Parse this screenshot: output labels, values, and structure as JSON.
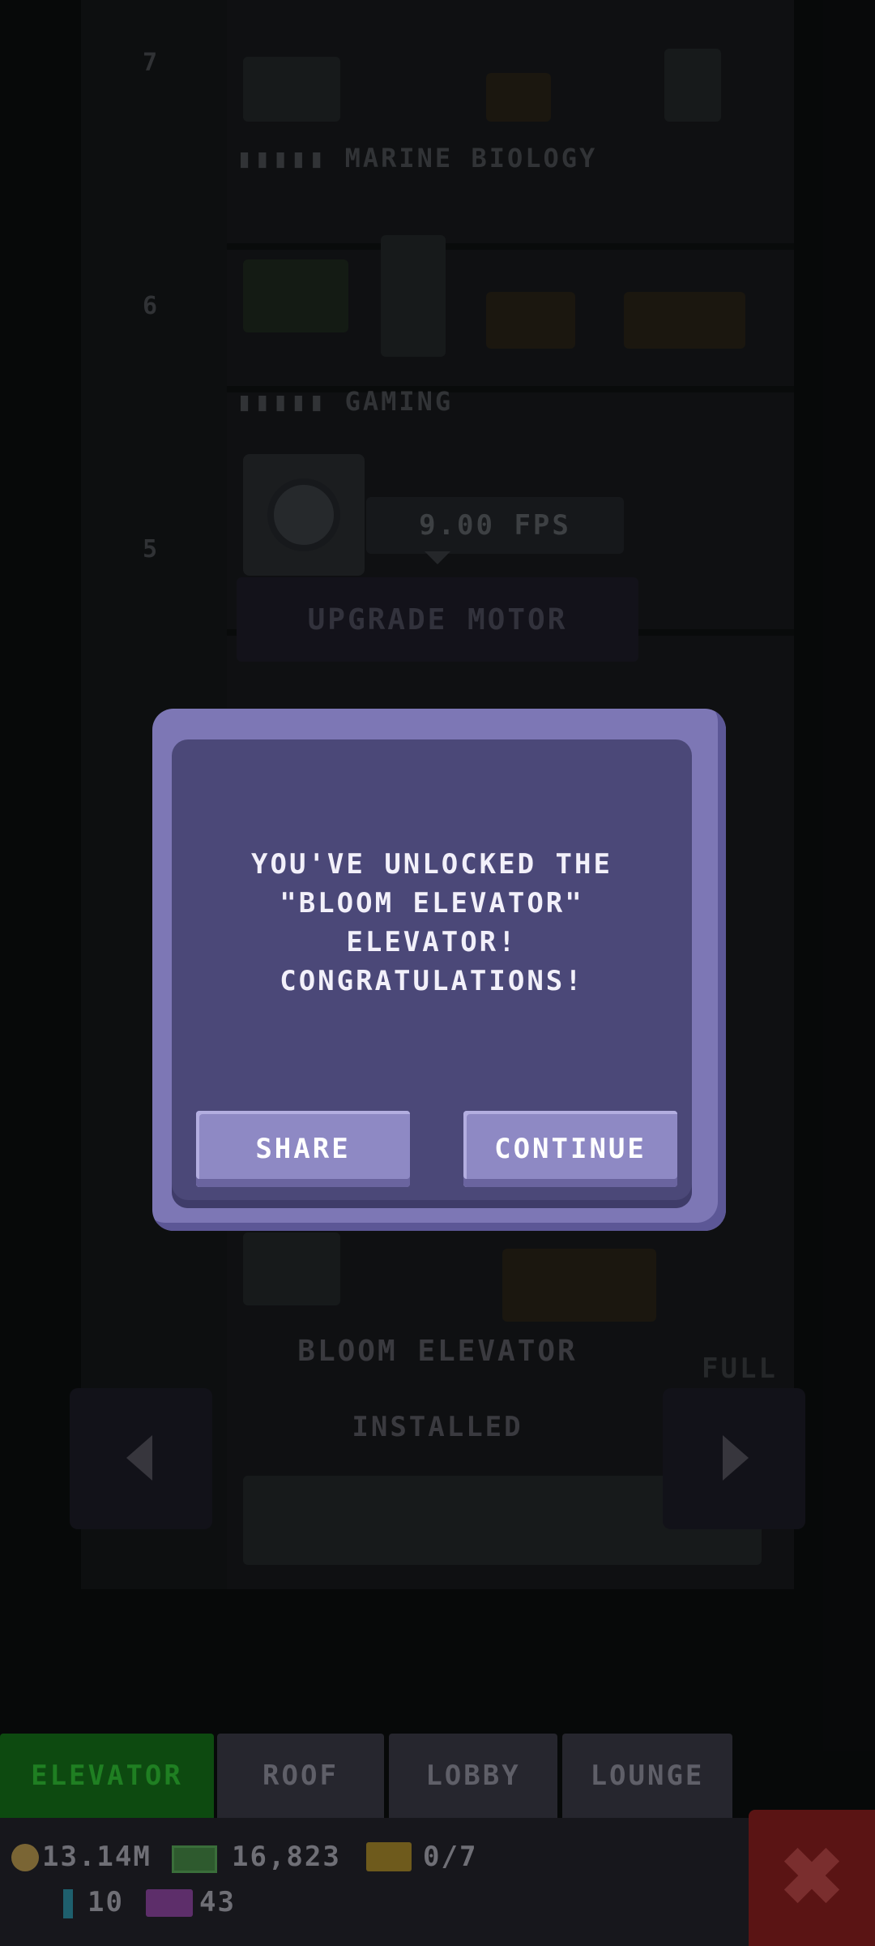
{
  "scene": {
    "floors": [
      {
        "label": "▮▮▮▮▮ MARINE BIOLOGY",
        "number": "7"
      },
      {
        "label": "▮▮▮▮▮ GAMING",
        "number": "6"
      },
      {
        "label": "",
        "number": "5"
      }
    ],
    "motor": {
      "fps": "9.00 FPS",
      "upgrade_label": "UPGRADE MOTOR"
    },
    "elevator_name": "BLOOM ELEVATOR",
    "elevator_status": "INSTALLED",
    "ghost_label": "FULL"
  },
  "modal": {
    "message_lines": [
      "YOU'VE UNLOCKED THE",
      "\"BLOOM ELEVATOR\"",
      "ELEVATOR!",
      "CONGRATULATIONS!"
    ],
    "share_label": "SHARE",
    "continue_label": "CONTINUE"
  },
  "tabs": [
    {
      "label": "ELEVATOR",
      "active": true
    },
    {
      "label": "ROOF",
      "active": false
    },
    {
      "label": "LOBBY",
      "active": false
    },
    {
      "label": "LOUNGE",
      "active": false
    }
  ],
  "status": {
    "coins": "13.14M",
    "cash": "16,823",
    "tickets": "0/7",
    "bars": "10",
    "tower_bux": "43"
  },
  "colors": {
    "modal_frame": "#7d77b5",
    "modal_panel": "#4b4878",
    "button": "#8e89c4",
    "active_tab": "#0d4a10",
    "close": "#5a1414"
  }
}
